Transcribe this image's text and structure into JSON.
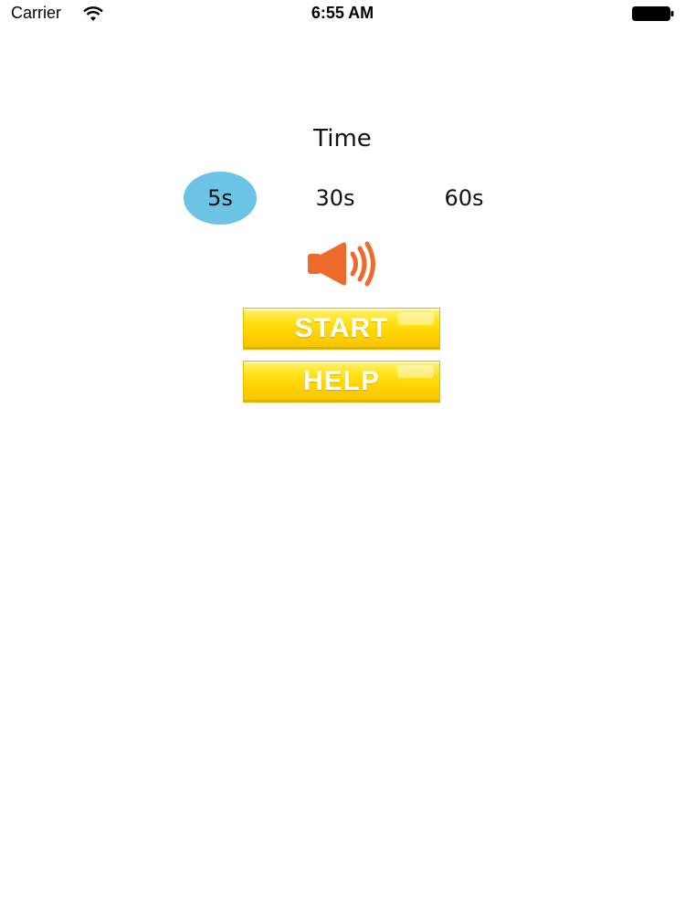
{
  "status_bar": {
    "carrier": "Carrier",
    "time": "6:55 AM",
    "icons": [
      "wifi-icon",
      "battery-icon"
    ]
  },
  "time_selector": {
    "title": "Time",
    "options": [
      "5s",
      "30s",
      "60s"
    ],
    "selected": "5s",
    "selected_color": "#6cc4e4"
  },
  "sound": {
    "icon": "speaker-icon",
    "color": "#ee6a2a"
  },
  "buttons": {
    "start_label": "START",
    "help_label": "HELP",
    "color": "#ffd400"
  }
}
